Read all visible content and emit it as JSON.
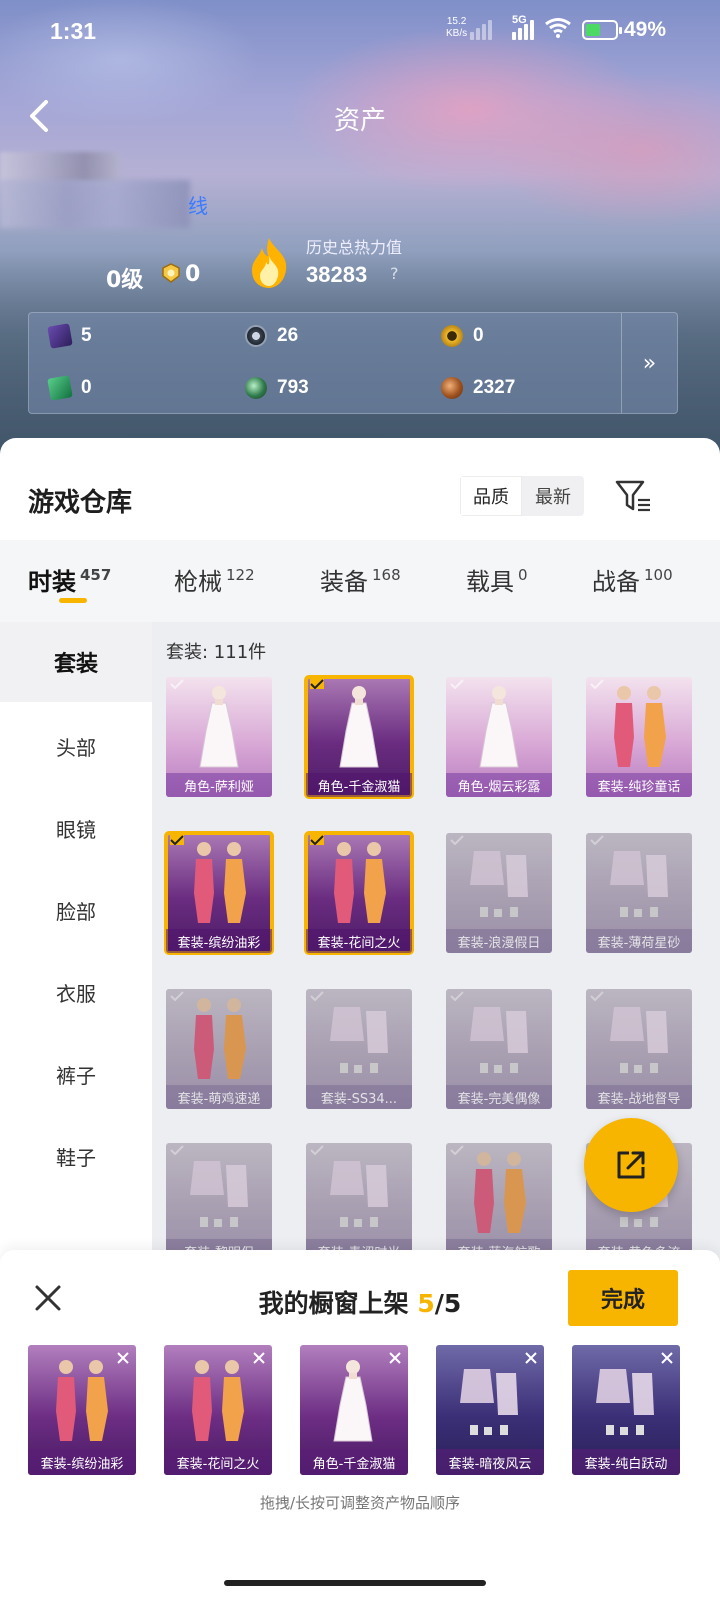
{
  "status_bar": {
    "time": "1:31",
    "net_speed": "15.2",
    "net_unit": "KB/s",
    "network": "5G",
    "battery": "49%"
  },
  "header": {
    "title": "资产"
  },
  "profile": {
    "link_fragment": "线",
    "level": "0级",
    "medal_count": "0",
    "heat_label": "历史总热力值",
    "heat_value": "38283",
    "help": "?"
  },
  "currency": [
    {
      "icon": "card-icon",
      "value": "5"
    },
    {
      "icon": "coin-s-icon",
      "value": "26"
    },
    {
      "icon": "gold-badge-icon",
      "value": "0"
    },
    {
      "icon": "green-ticket-icon",
      "value": "0"
    },
    {
      "icon": "green-orb-icon",
      "value": "793"
    },
    {
      "icon": "bronze-coin-icon",
      "value": "2327"
    }
  ],
  "currency_more": "»",
  "warehouse": {
    "title": "游戏仓库",
    "sort": [
      "品质",
      "最新"
    ]
  },
  "tabs": [
    {
      "label": "时装",
      "count": "457"
    },
    {
      "label": "枪械",
      "count": "122"
    },
    {
      "label": "装备",
      "count": "168"
    },
    {
      "label": "载具",
      "count": "0"
    },
    {
      "label": "战备",
      "count": "100"
    }
  ],
  "sidebar": [
    "套装",
    "头部",
    "眼镜",
    "脸部",
    "衣服",
    "裤子",
    "鞋子"
  ],
  "grid_label": "套装: 111件",
  "items": [
    {
      "label": "角色-萨利娅"
    },
    {
      "label": "角色-千金淑猫"
    },
    {
      "label": "角色-烟云彩露"
    },
    {
      "label": "套装-纯珍童话"
    },
    {
      "label": "套装-缤纷油彩"
    },
    {
      "label": "套装-花间之火"
    },
    {
      "label": "套装-浪漫假日"
    },
    {
      "label": "套装-薄荷星砂"
    },
    {
      "label": "套装-萌鸡速递"
    },
    {
      "label": "套装-SS34..."
    },
    {
      "label": "套装-完美偶像"
    },
    {
      "label": "套装-战地督导"
    },
    {
      "label": "套装-黎明保"
    },
    {
      "label": "套装-青涩时光"
    },
    {
      "label": "套装-蓝海航歌"
    },
    {
      "label": "套装-黄色多流"
    }
  ],
  "sheet": {
    "title": "我的橱窗上架",
    "count_current": "5",
    "count_total": "/5",
    "done": "完成",
    "hint": "拖拽/长按可调整资产物品顺序",
    "shelf": [
      {
        "label": "套装-缤纷油彩"
      },
      {
        "label": "套装-花间之火"
      },
      {
        "label": "角色-千金淑猫"
      },
      {
        "label": "套装-暗夜风云"
      },
      {
        "label": "套装-纯白跃动"
      }
    ]
  },
  "colors": {
    "accent": "#f7b500",
    "panel_bg": "#ffffff",
    "tab_bg": "#f5f6f8"
  }
}
